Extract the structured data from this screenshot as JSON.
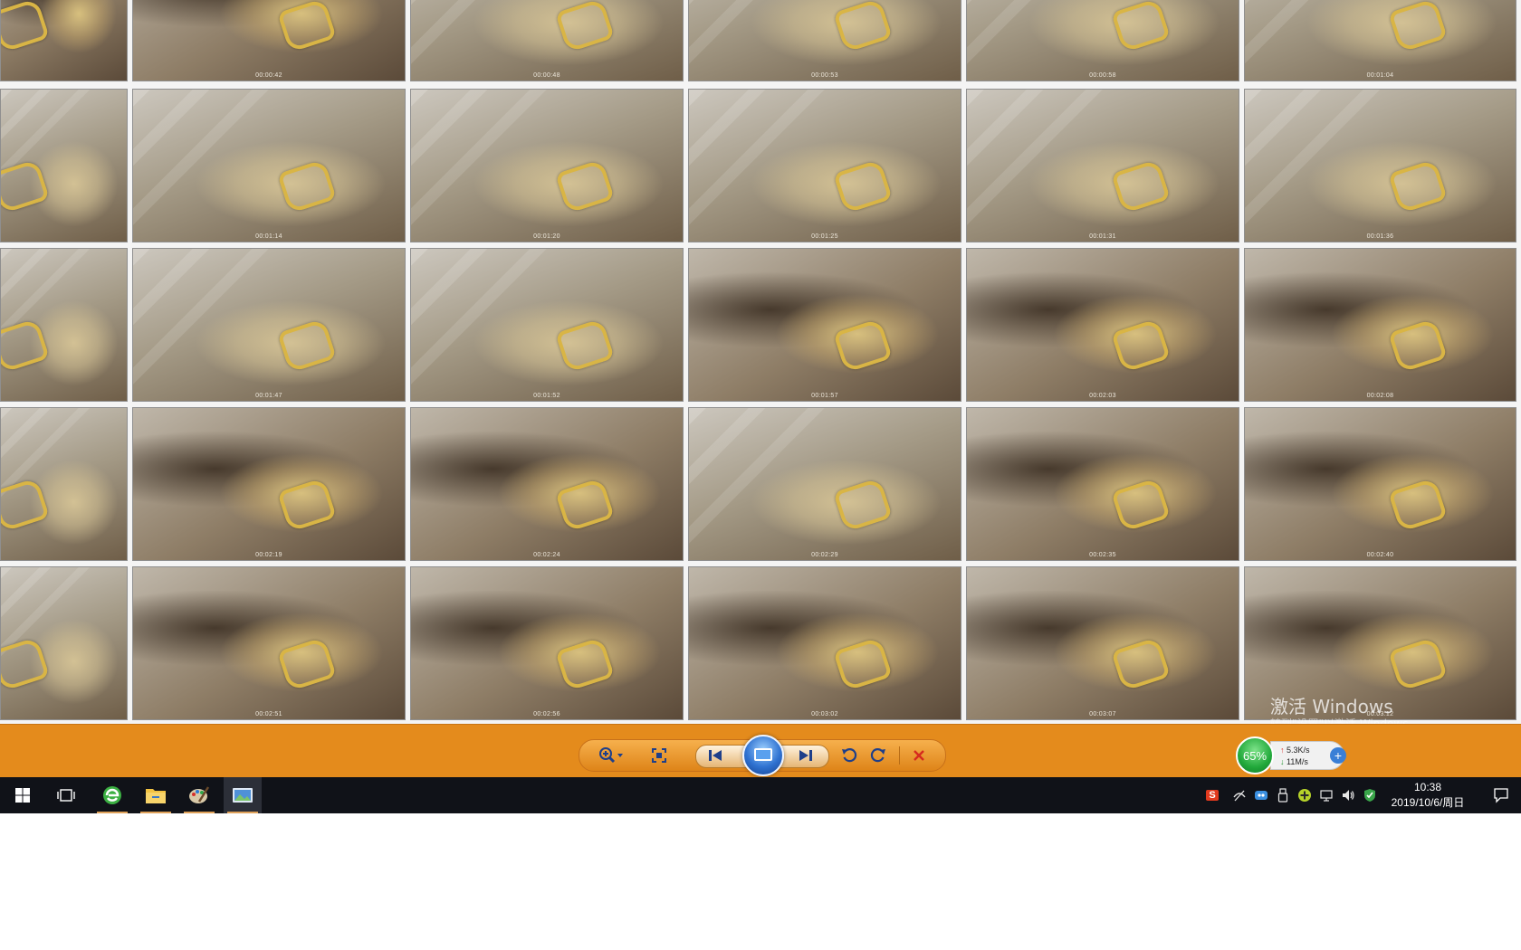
{
  "thumbnails": [
    {
      "time": "",
      "style": "alt"
    },
    {
      "time": "00:00:42",
      "style": "alt"
    },
    {
      "time": "00:00:48",
      "style": "plain"
    },
    {
      "time": "00:00:53",
      "style": "plain"
    },
    {
      "time": "00:00:58",
      "style": "plain"
    },
    {
      "time": "00:01:04",
      "style": "plain"
    },
    {
      "time": "",
      "style": "plain"
    },
    {
      "time": "00:01:14",
      "style": "plain"
    },
    {
      "time": "00:01:20",
      "style": "plain"
    },
    {
      "time": "00:01:25",
      "style": "plain"
    },
    {
      "time": "00:01:31",
      "style": "plain"
    },
    {
      "time": "00:01:36",
      "style": "plain"
    },
    {
      "time": "",
      "style": "plain"
    },
    {
      "time": "00:01:47",
      "style": "plain"
    },
    {
      "time": "00:01:52",
      "style": "plain"
    },
    {
      "time": "00:01:57",
      "style": "alt"
    },
    {
      "time": "00:02:03",
      "style": "alt"
    },
    {
      "time": "00:02:08",
      "style": "alt"
    },
    {
      "time": "",
      "style": "plain"
    },
    {
      "time": "00:02:19",
      "style": "alt"
    },
    {
      "time": "00:02:24",
      "style": "alt"
    },
    {
      "time": "00:02:29",
      "style": "plain"
    },
    {
      "time": "00:02:35",
      "style": "alt"
    },
    {
      "time": "00:02:40",
      "style": "alt"
    },
    {
      "time": "",
      "style": "plain"
    },
    {
      "time": "00:02:51",
      "style": "alt"
    },
    {
      "time": "00:02:56",
      "style": "alt"
    },
    {
      "time": "00:03:02",
      "style": "alt"
    },
    {
      "time": "00:03:07",
      "style": "alt"
    },
    {
      "time": "00:03:12",
      "style": "alt"
    }
  ],
  "watermark": {
    "title": "激活 Windows",
    "subtitle": "转到\"设置\"以激活 Windows。"
  },
  "toolbar": {
    "background": "#e48b1c",
    "buttons": [
      {
        "name": "zoom-button",
        "icon": "zoom-icon"
      },
      {
        "name": "actual-size-button",
        "icon": "fit-icon"
      },
      {
        "name": "previous-button",
        "icon": "skip-previous-icon"
      },
      {
        "name": "slideshow-button",
        "icon": "slideshow-icon"
      },
      {
        "name": "next-button",
        "icon": "skip-next-icon"
      },
      {
        "name": "rotate-left-button",
        "icon": "rotate-ccw-icon"
      },
      {
        "name": "rotate-right-button",
        "icon": "rotate-cw-icon"
      },
      {
        "name": "delete-button",
        "icon": "close-icon"
      }
    ]
  },
  "network": {
    "percent": "65%",
    "upload": "5.3K/s",
    "download": "11M/s"
  },
  "taskbar": {
    "apps": [
      {
        "name": "start-button",
        "icon": "windows-logo-icon"
      },
      {
        "name": "task-view-button",
        "icon": "task-view-icon"
      },
      {
        "name": "browser-app",
        "icon": "browser-icon"
      },
      {
        "name": "file-explorer-app",
        "icon": "folder-icon"
      },
      {
        "name": "paint-app",
        "icon": "palette-icon"
      },
      {
        "name": "photo-viewer-app",
        "icon": "photo-icon"
      }
    ],
    "clock": {
      "time": "10:38",
      "date": "2019/10/6/周日"
    }
  }
}
